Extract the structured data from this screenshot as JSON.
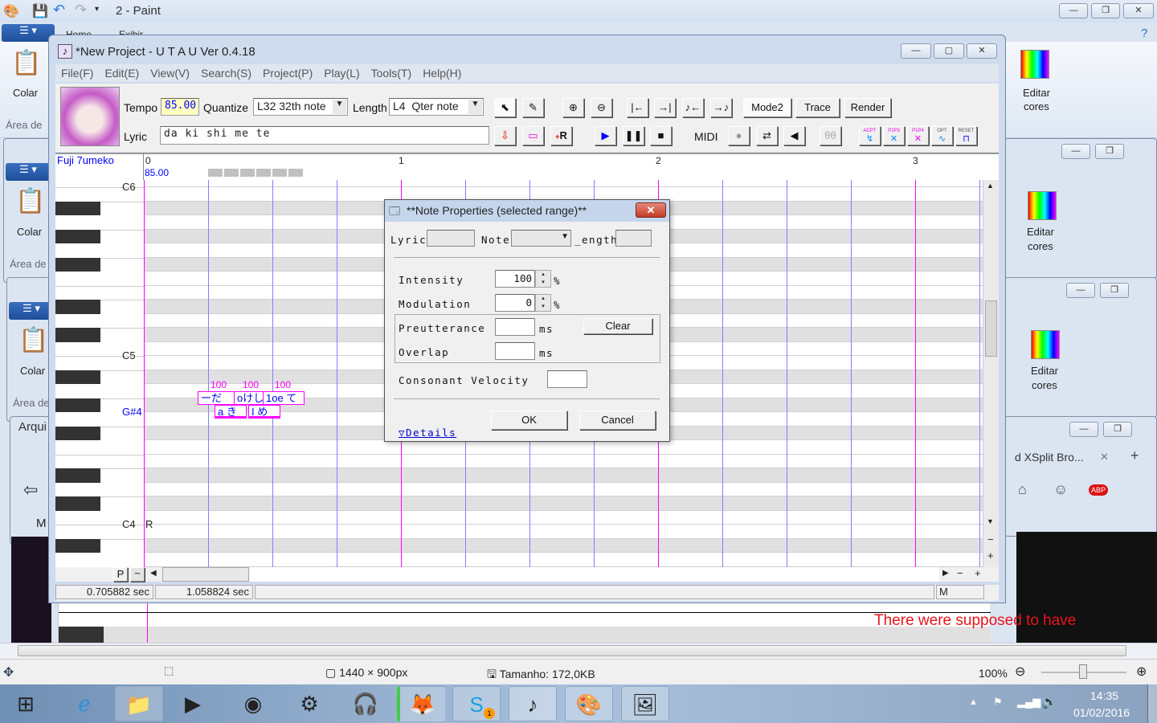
{
  "paint": {
    "title": "2 - Paint",
    "tab_home": "Home",
    "tab_view": "Exibir",
    "colar": "Colar",
    "area": "Área de",
    "editar": "Editar",
    "cores": "cores",
    "arqui": "Arqui",
    "m": "M",
    "xsplit_tab": "d XSplit Bro...",
    "overlay_text": "There were supposed to have",
    "status_size": "1440 × 900px",
    "status_file": "Tamanho: 172,0KB",
    "zoom": "100%",
    "zoom_level_percent": 100
  },
  "utau": {
    "title": "*New Project - U T A U Ver 0.4.18",
    "menu": [
      "File(F)",
      "Edit(E)",
      "View(V)",
      "Search(S)",
      "Project(P)",
      "Play(L)",
      "Tools(T)",
      "Help(H)"
    ],
    "tempo_label": "Tempo",
    "tempo": "85.00",
    "quantize_label": "Quantize",
    "quantize": "L32 32th note",
    "length_label": "Length",
    "length": "L4  Qter note",
    "lyric_label": "Lyric",
    "lyric": "da ki shi me te",
    "mode2": "Mode2",
    "trace": "Trace",
    "render": "Render",
    "midi": "MIDI",
    "small_icons": [
      "ACPT",
      "P2P3",
      "P1P4",
      "OPT",
      "RESET"
    ],
    "voicebank": "Fuji 7umeko",
    "ruler_start": "0",
    "ruler_tempo": "85.00",
    "measures": [
      "1",
      "2",
      "3"
    ],
    "octave_labels": [
      "C6",
      "C5",
      "G#4",
      "C4"
    ],
    "rest_marker": "R",
    "notes_top": [
      {
        "text": "ーだ",
        "intensity": "100"
      },
      {
        "text": "oけし",
        "intensity": "100"
      },
      {
        "text": "1oe て",
        "intensity": "100"
      }
    ],
    "notes_bottom": [
      "a き",
      "I め"
    ],
    "p_btn": "P",
    "tilde_btn": "~",
    "time1": "0.705882 sec",
    "time2": "1.058824 sec",
    "mode_m": "M"
  },
  "dialog": {
    "title": "**Note Properties (selected range)**",
    "lyric": "Lyric",
    "note": "Note",
    "length": "_ength",
    "intensity": "Intensity",
    "intensity_val": "100",
    "modulation": "Modulation",
    "modulation_val": "0",
    "pct": "%",
    "preutterance": "Preutterance",
    "overlap": "Overlap",
    "ms": "ms",
    "clear": "Clear",
    "consonant": "Consonant Velocity",
    "ok": "OK",
    "cancel": "Cancel",
    "details": "▽Details"
  },
  "taskbar": {
    "time": "14:35",
    "date": "01/02/2016",
    "skype_badge": "1"
  },
  "colors": {
    "measure_line": "#ff00ff",
    "beat_line": "#8080ff",
    "accent": "#0000ff"
  }
}
